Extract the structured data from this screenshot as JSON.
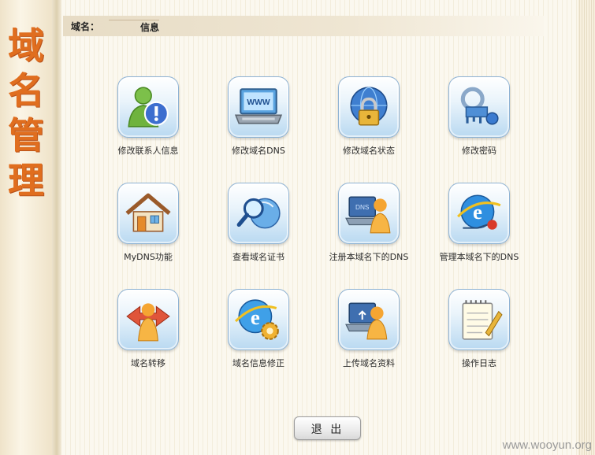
{
  "sidebar": {
    "title_chars": [
      "域",
      "名",
      "管",
      "理"
    ]
  },
  "info_bar": {
    "label": "域名：",
    "value": "信息"
  },
  "tiles": [
    {
      "label": "修改联系人信息",
      "icon": "contact-info-icon"
    },
    {
      "label": "修改域名DNS",
      "icon": "laptop-www-icon"
    },
    {
      "label": "修改域名状态",
      "icon": "globe-lock-icon"
    },
    {
      "label": "修改密码",
      "icon": "key-password-icon"
    },
    {
      "label": "MyDNS功能",
      "icon": "house-icon"
    },
    {
      "label": "查看域名证书",
      "icon": "magnifier-certificate-icon"
    },
    {
      "label": "注册本域名下的DNS",
      "icon": "register-dns-icon"
    },
    {
      "label": "管理本域名下的DNS",
      "icon": "ie-network-icon"
    },
    {
      "label": "域名转移",
      "icon": "user-transfer-icon"
    },
    {
      "label": "域名信息修正",
      "icon": "ie-gear-icon"
    },
    {
      "label": "上传域名资料",
      "icon": "upload-user-icon"
    },
    {
      "label": "操作日志",
      "icon": "notepad-log-icon"
    }
  ],
  "logout_label": "退 出",
  "watermark": "www.wooyun.org"
}
